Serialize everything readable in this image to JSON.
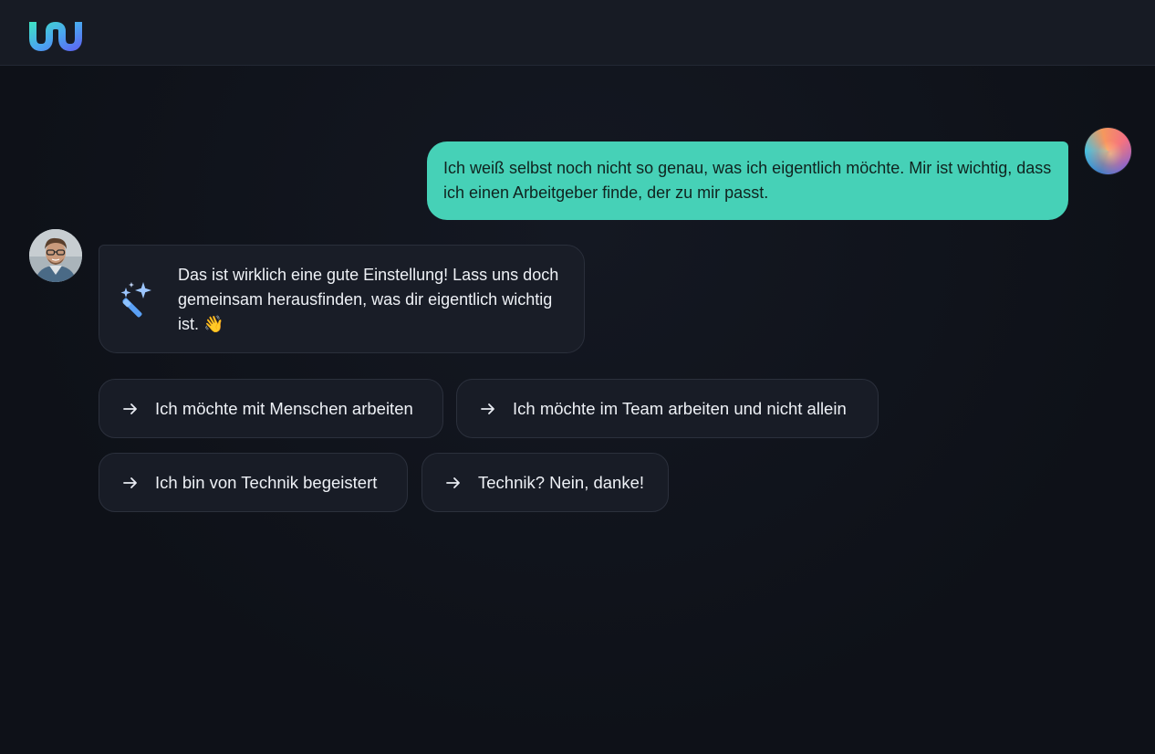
{
  "header": {
    "logo_icon": "wave-logo-icon"
  },
  "conversation": {
    "user_message": "Ich weiß selbst noch nicht so genau, was ich eigentlich möchte. Mir ist wichtig, dass ich einen Arbeitgeber finde, der zu mir passt.",
    "user_avatar_icon": "gradient-orb-avatar",
    "assistant_avatar_icon": "person-photo-avatar",
    "assistant_icon": "magic-wand-icon",
    "assistant_message": "Das ist wirklich eine gute Einstellung! Lass uns doch gemeinsam herausfinden, was dir eigentlich wichtig ist. 👋"
  },
  "suggestions": [
    {
      "label": "Ich möchte mit Menschen arbeiten",
      "icon": "arrow-right-icon"
    },
    {
      "label": "Ich möchte im Team arbeiten und nicht allein",
      "icon": "arrow-right-icon"
    },
    {
      "label": "Ich bin von Technik begeistert",
      "icon": "arrow-right-icon"
    },
    {
      "label": "Technik? Nein, danke!",
      "icon": "arrow-right-icon"
    }
  ],
  "colors": {
    "background": "#0f121a",
    "user_bubble": "#46d1b7",
    "assistant_bubble": "#191d27",
    "chip_background": "#181c26"
  }
}
